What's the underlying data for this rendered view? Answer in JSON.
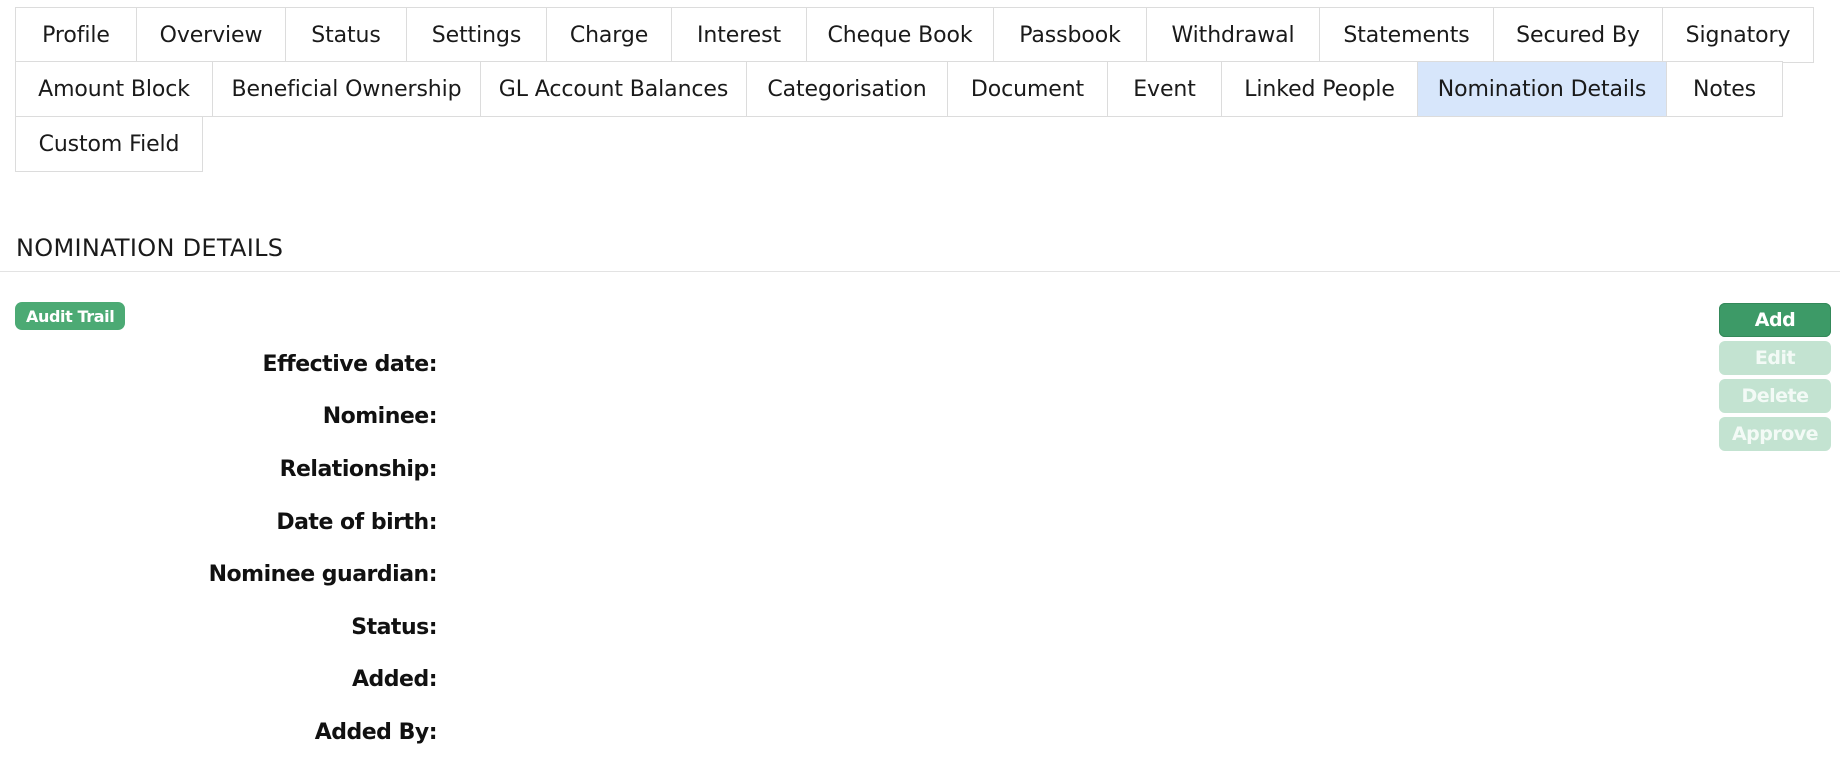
{
  "tabs": {
    "row1": [
      {
        "label": "Profile"
      },
      {
        "label": "Overview"
      },
      {
        "label": "Status"
      },
      {
        "label": "Settings"
      },
      {
        "label": "Charge"
      },
      {
        "label": "Interest"
      },
      {
        "label": "Cheque Book"
      },
      {
        "label": "Passbook"
      },
      {
        "label": "Withdrawal"
      },
      {
        "label": "Statements"
      },
      {
        "label": "Secured By"
      },
      {
        "label": "Signatory"
      }
    ],
    "row2": [
      {
        "label": "Amount Block"
      },
      {
        "label": "Beneficial Ownership"
      },
      {
        "label": "GL Account Balances"
      },
      {
        "label": "Categorisation"
      },
      {
        "label": "Document"
      },
      {
        "label": "Event"
      },
      {
        "label": "Linked People"
      },
      {
        "label": "Nomination Details"
      },
      {
        "label": "Notes"
      }
    ],
    "row3": [
      {
        "label": "Custom Field"
      }
    ],
    "active": "Nomination Details"
  },
  "section": {
    "title": "NOMINATION DETAILS",
    "audit_trail_label": "Audit Trail"
  },
  "fields": [
    {
      "label": "Effective date:"
    },
    {
      "label": "Nominee:"
    },
    {
      "label": "Relationship:"
    },
    {
      "label": "Date of birth:"
    },
    {
      "label": "Nominee guardian:"
    },
    {
      "label": "Status:"
    },
    {
      "label": "Added:"
    },
    {
      "label": "Added By:"
    }
  ],
  "actions": {
    "add_label": "Add",
    "edit_label": "Edit",
    "delete_label": "Delete",
    "approve_label": "Approve"
  },
  "colors": {
    "active_tab_bg": "#d7e6fb",
    "primary_green": "#3d9a67",
    "badge_green": "#4caa74",
    "disabled_green": "#c3e3d1",
    "tab_border": "#dcdcdc"
  }
}
